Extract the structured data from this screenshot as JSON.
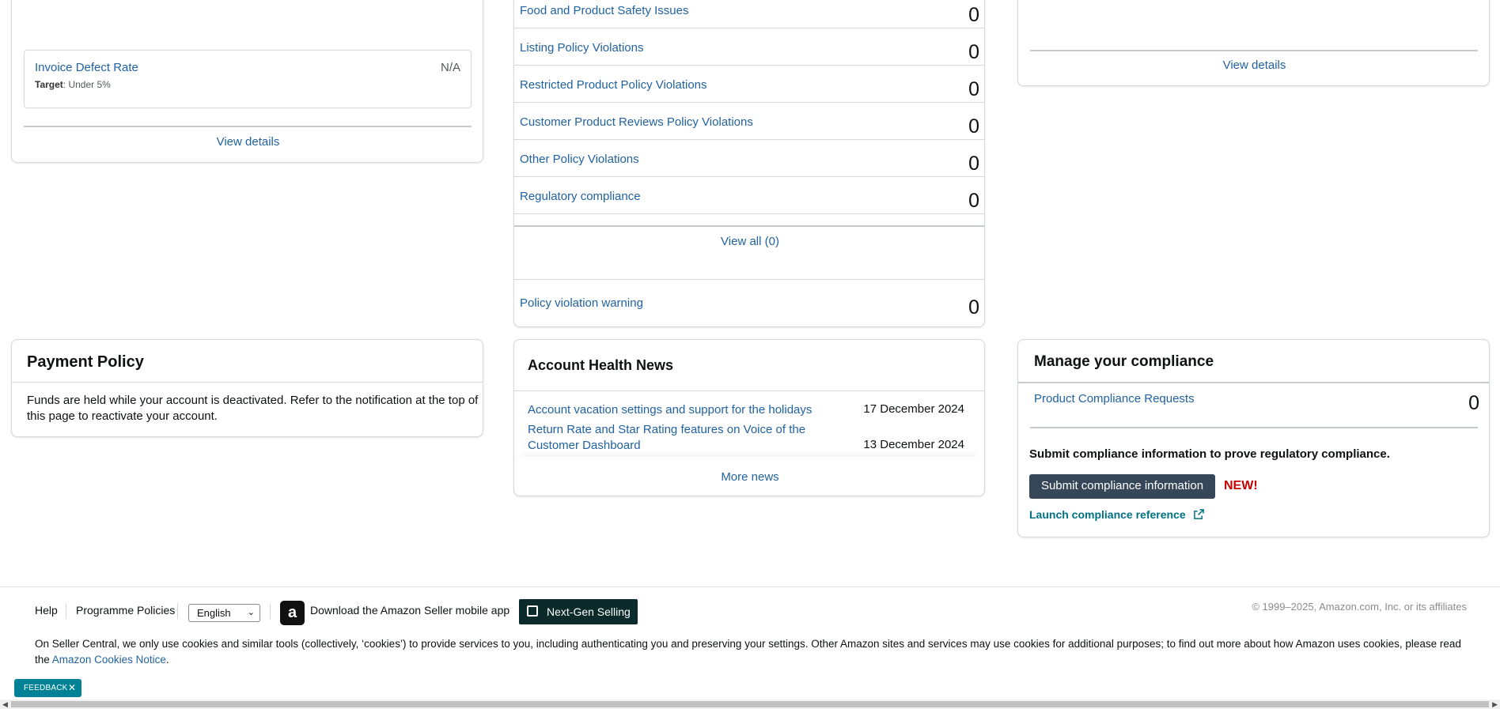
{
  "left_card": {
    "metric_name": "Invoice Defect Rate",
    "metric_value": "N/A",
    "target_label": "Target",
    "target_value": ": Under 5%",
    "view_details": "View details"
  },
  "policy_list": {
    "rows": [
      {
        "label": "Food and Product Safety Issues",
        "count": "0"
      },
      {
        "label": "Listing Policy Violations",
        "count": "0"
      },
      {
        "label": "Restricted Product Policy Violations",
        "count": "0"
      },
      {
        "label": "Customer Product Reviews Policy Violations",
        "count": "0"
      },
      {
        "label": "Other Policy Violations",
        "count": "0"
      },
      {
        "label": "Regulatory compliance",
        "count": "0"
      }
    ],
    "view_all": "View all (0)",
    "warning_label": "Policy violation warning",
    "warning_count": "0"
  },
  "right_card": {
    "view_details": "View details"
  },
  "payment_policy": {
    "title": "Payment Policy",
    "line1": "Funds are held while your account is deactivated. Refer to the notification at the top of",
    "line2": "this page to reactivate your account."
  },
  "news": {
    "title": "Account Health News",
    "items": [
      {
        "line1": "Account vacation settings and support for the holidays",
        "line2": "",
        "date": "17 December 2024"
      },
      {
        "line1": "Return Rate and Star Rating features on Voice of the",
        "line2": "Customer Dashboard",
        "date": "13 December 2024"
      }
    ],
    "more": "More news"
  },
  "compliance": {
    "title": "Manage your compliance",
    "requests_label": "Product Compliance Requests",
    "requests_count": "0",
    "description": "Submit compliance information to prove regulatory compliance.",
    "submit_button": "Submit compliance information",
    "new_badge": "NEW!",
    "launch_link": "Launch compliance reference"
  },
  "footer": {
    "help": "Help",
    "programme_policies": "Programme Policies",
    "language": "English",
    "app_icon": "a",
    "app_download": "Download the Amazon Seller mobile app",
    "next_gen": "Next-Gen Selling",
    "copyright": "© 1999–2025, Amazon.com, Inc. or its affiliates",
    "cookie_text": "On Seller Central, we only use cookies and similar tools (collectively, ‘cookies’) to provide services to you, including authenticating you and preserving your settings. Other Amazon sites and services may use cookies for additional purposes; to find out more about how Amazon uses cookies, please read the",
    "cookie_link": "Amazon Cookies Notice",
    "cookie_end": "."
  },
  "feedback": {
    "label": "FEEDBACK",
    "close": "✕"
  },
  "icons": {
    "external_link": "external-link-icon",
    "chevron": "chevron-down-icon",
    "close": "close-icon"
  },
  "colors": {
    "link": "#2162a1",
    "dark_button": "#37475a",
    "new_badge": "#c40000",
    "teal_link": "#007185",
    "feedback_bg": "#008296",
    "next_gen_bg": "#0b2b2b"
  }
}
